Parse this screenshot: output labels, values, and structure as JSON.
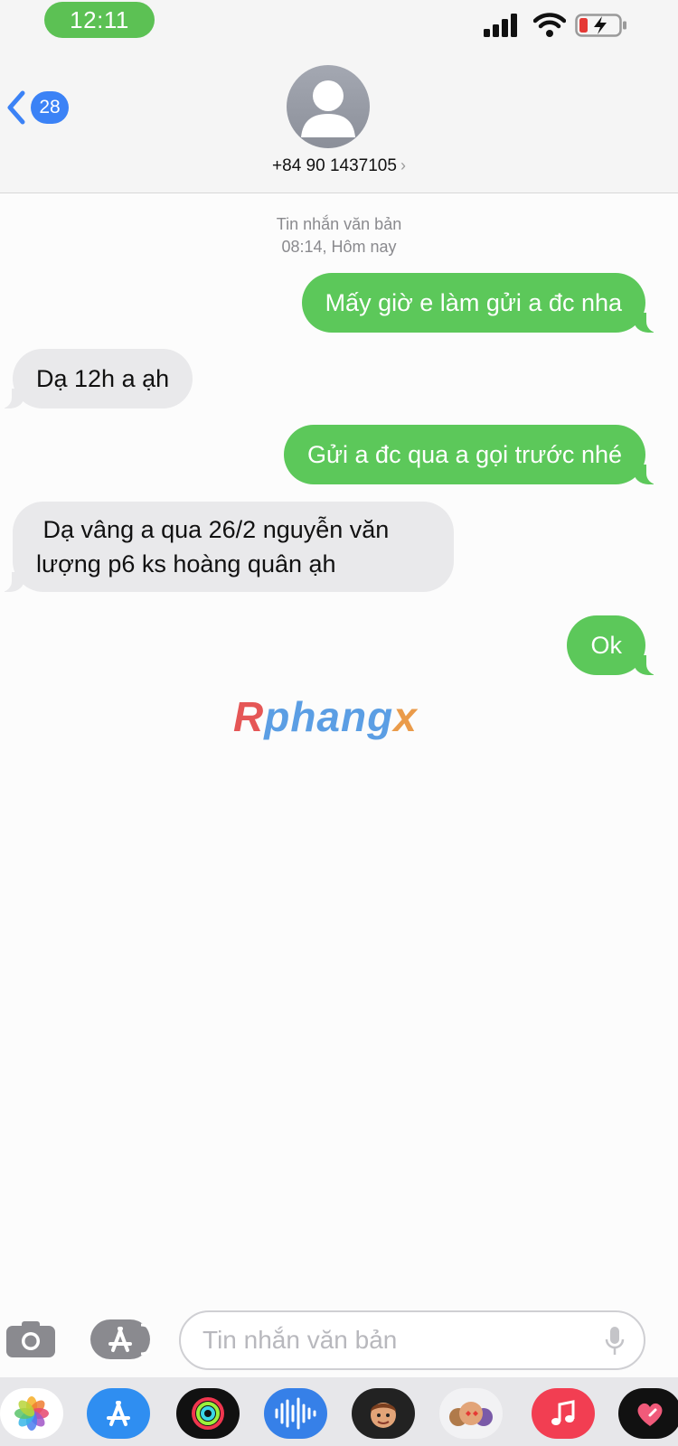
{
  "status_bar": {
    "time": "12:11"
  },
  "header": {
    "back_count": "28",
    "contact": "+84 90 1437105",
    "chevron": "›"
  },
  "thread": {
    "service": "Tin nhắn văn bản",
    "timestamp": "08:14, Hôm nay"
  },
  "messages": [
    {
      "direction": "outgoing",
      "text": "Mấy giờ e làm gửi a đc nha"
    },
    {
      "direction": "incoming",
      "text": "Dạ 12h a ạh"
    },
    {
      "direction": "outgoing",
      "text": "Gửi a đc qua a gọi trước nhé"
    },
    {
      "direction": "incoming",
      "text": " Dạ vâng a qua 26/2 nguyễn văn lượng p6 ks hoàng quân ạh"
    },
    {
      "direction": "outgoing",
      "text": "Ok"
    }
  ],
  "watermark": {
    "first": "R",
    "middle": "phang",
    "last": "x"
  },
  "compose": {
    "placeholder": "Tin nhắn văn bản"
  },
  "icons": [
    "back-chevron-icon",
    "person-icon",
    "camera-icon",
    "app-store-icon",
    "microphone-icon",
    "photos-icon",
    "activity-icon",
    "audio-icon",
    "memoji-icon",
    "music-icon",
    "heart-icon"
  ],
  "colors": {
    "outgoing_bubble": "#5cc85a",
    "incoming_bubble": "#e9e9eb",
    "accent": "#3b82f6"
  }
}
